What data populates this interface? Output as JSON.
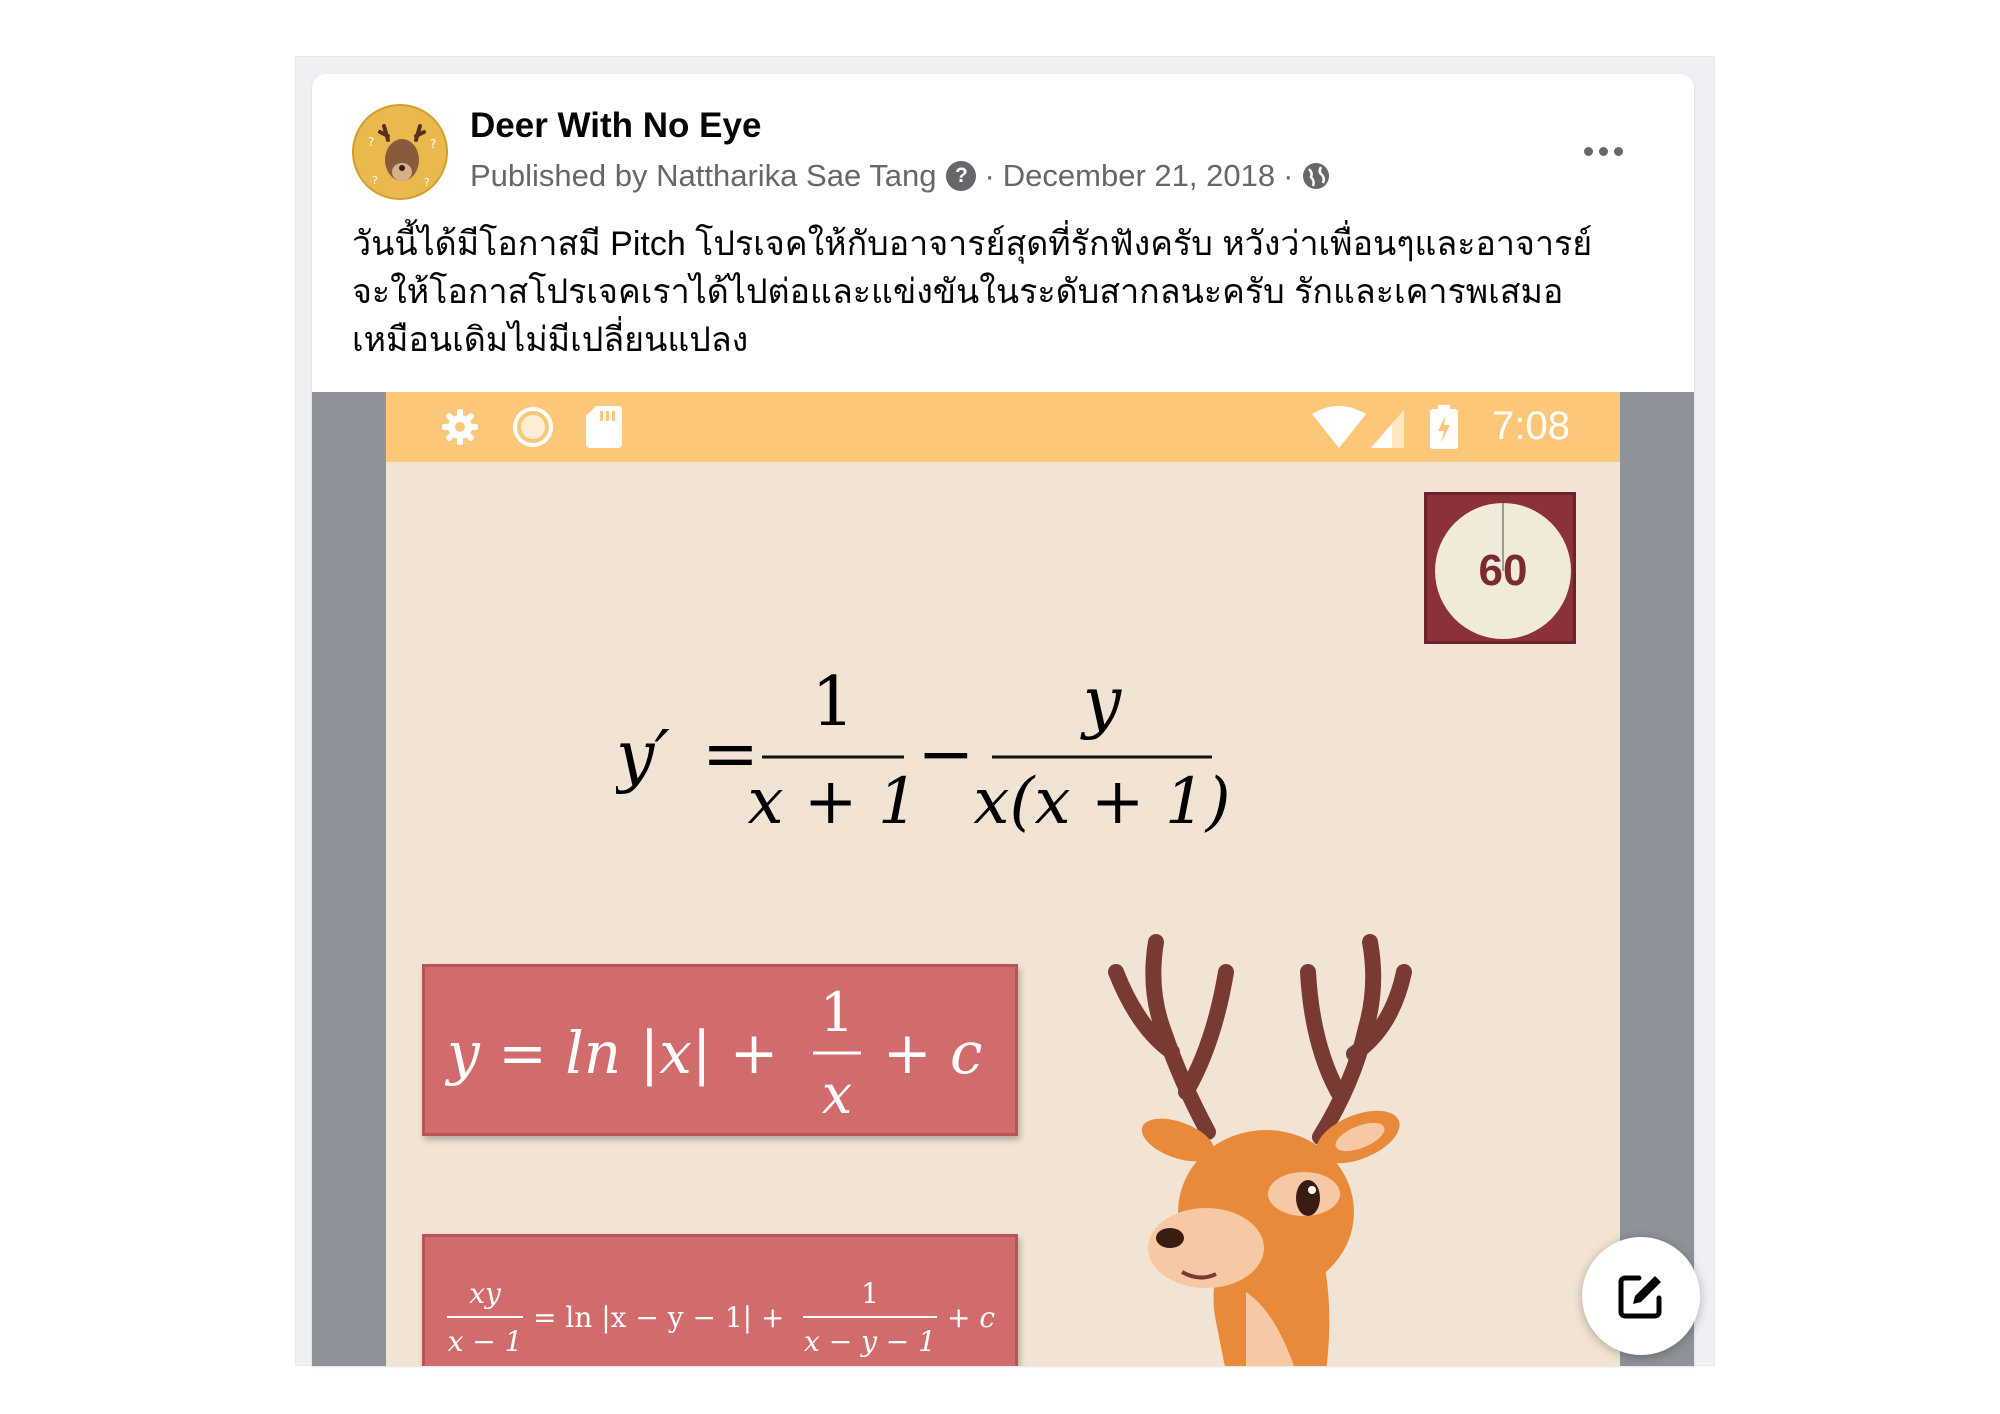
{
  "post": {
    "page_name": "Deer With No Eye",
    "published_by": "Published by Nattharika Sae Tang",
    "date": "December 21, 2018",
    "separator": "·",
    "text_line1": "วันนี้ได้มีโอกาสมี Pitch โปรเจคให้กับอาจารย์สุดที่รักฟังครับ หวังว่าเพื่อนๆและอาจารย์",
    "text_line2": "จะให้โอกาสโปรเจคเราได้ไปต่อและแข่งขันในระดับสากลนะครับ รักและเคารพเสมอ",
    "text_line3": "เหมือนเดิมไม่มีเปลี่ยนแปลง"
  },
  "icons": {
    "more": "more-horizontal-icon",
    "help": "question-circle-icon",
    "audience": "globe-icon",
    "compose": "edit-compose-icon"
  },
  "app": {
    "status_time": "7:08",
    "timer_value": "60",
    "equation": {
      "lhs": "y′",
      "equals": "=",
      "frac1_num": "1",
      "frac1_den": "x + 1",
      "minus": "−",
      "frac2_num": "y",
      "frac2_den": "x(x + 1)"
    },
    "answer1": {
      "left": "y = ln |x| +",
      "frac_num": "1",
      "frac_den": "x",
      "right": "+ c"
    },
    "answer2": {
      "frac1_num": "xy",
      "frac1_den": "x − 1",
      "middle": "= ln |x − y − 1| +",
      "frac2_num": "1",
      "frac2_den": "x − y − 1",
      "right": "+ c"
    }
  },
  "colors": {
    "status_bar": "#fdc77a",
    "app_background": "#f2e4d4",
    "answer_box": "#d26b6b",
    "timer_frame": "#8b3139",
    "deer_body": "#e98a3a",
    "antler": "#7a3a34"
  }
}
